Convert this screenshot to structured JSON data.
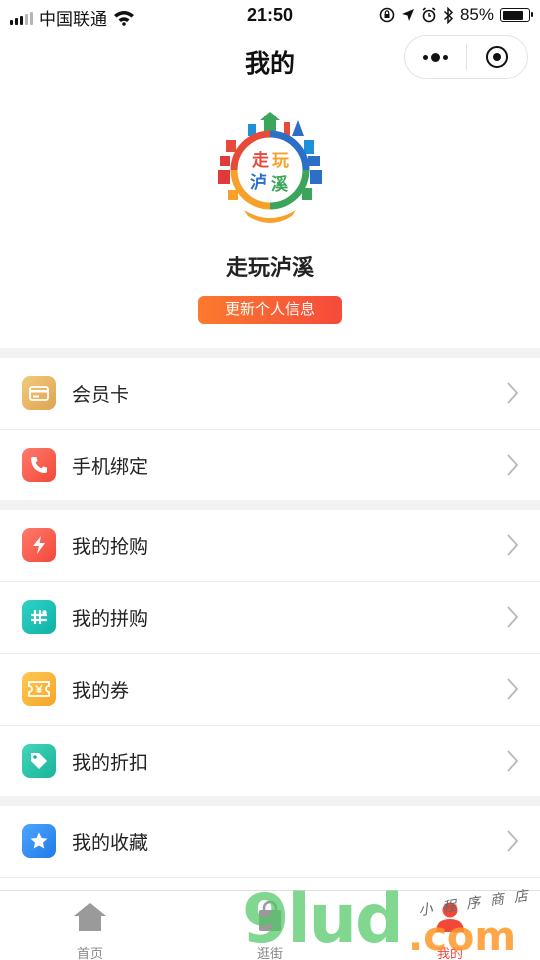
{
  "status_bar": {
    "carrier": "中国联通",
    "time": "21:50",
    "battery": "85%",
    "battery_level": 0.85,
    "icons": [
      "signal-icon",
      "wifi-icon",
      "orientation-lock-icon",
      "location-icon",
      "alarm-icon",
      "bluetooth-icon",
      "battery-icon"
    ]
  },
  "nav": {
    "title": "我的",
    "icons": [
      "more-icon",
      "close-miniprogram-icon"
    ]
  },
  "profile": {
    "logo_text": [
      "走",
      "玩",
      "泸",
      "溪"
    ],
    "name": "走玩泸溪",
    "update_button": "更新个人信息"
  },
  "colors": {
    "accent": "#f2483a",
    "button_gradient": [
      "#fb7a2d",
      "#f64a3c"
    ],
    "divider": "#f2f2f2"
  },
  "menu": {
    "groups": [
      [
        {
          "label": "会员卡",
          "icon": "card-icon",
          "color": "#e8b463"
        },
        {
          "label": "手机绑定",
          "icon": "phone-icon",
          "color": "#f65a54"
        }
      ],
      [
        {
          "label": "我的抢购",
          "icon": "flash-icon",
          "color": "#f65a54"
        },
        {
          "label": "我的拼购",
          "icon": "group-buy-icon",
          "color": "#17c3bb"
        },
        {
          "label": "我的券",
          "icon": "coupon-icon",
          "color": "#fcb43a"
        },
        {
          "label": "我的折扣",
          "icon": "tag-icon",
          "color": "#27c6b4"
        }
      ],
      [
        {
          "label": "我的收藏",
          "icon": "star-icon",
          "color": "#2f8cf5"
        }
      ]
    ]
  },
  "tabs": [
    {
      "label": "首页",
      "icon": "home-icon",
      "active": false
    },
    {
      "label": "逛街",
      "icon": "shopping-bag-icon",
      "active": false
    },
    {
      "label": "我的",
      "icon": "user-icon",
      "active": true
    }
  ],
  "watermark": {
    "main": "9lud",
    "suffix": ".com",
    "sub": "小程序商店"
  }
}
